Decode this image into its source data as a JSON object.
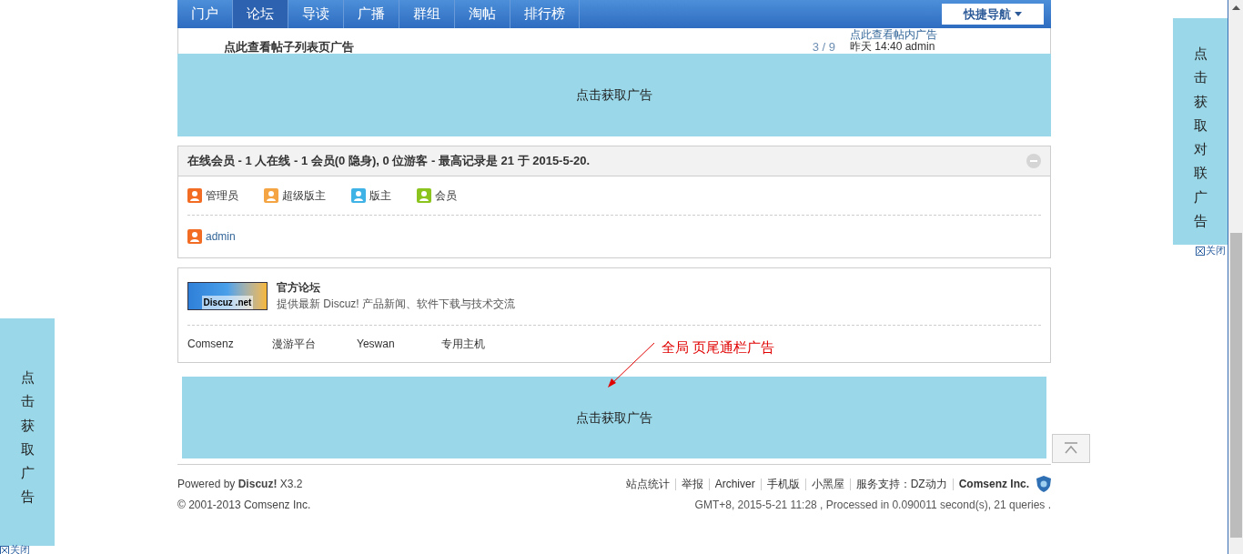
{
  "nav": {
    "items": [
      {
        "label": "门户",
        "selected": false
      },
      {
        "label": "论坛",
        "selected": true
      },
      {
        "label": "导读",
        "selected": false
      },
      {
        "label": "广播",
        "selected": false
      },
      {
        "label": "群组",
        "selected": false
      },
      {
        "label": "淘帖",
        "selected": false
      },
      {
        "label": "排行榜",
        "selected": false
      }
    ],
    "quick_nav": "快捷导航"
  },
  "thread_row": {
    "title": "点此查看帖子列表页广告",
    "pages": "3 / 9",
    "last_post_link": "点此查看帖内广告",
    "last_post": "昨天 14:40 admin"
  },
  "top_banner_ad": "点击获取广告",
  "online": {
    "header": "在线会员 - 1 人在线 - 1 会员(0 隐身), 0 位游客 - 最高记录是 21 于 2015-5-20.",
    "legend": [
      {
        "label": "管理员",
        "color": "#f26c24"
      },
      {
        "label": "超级版主",
        "color": "#f5a443"
      },
      {
        "label": "版主",
        "color": "#3fb2e6"
      },
      {
        "label": "会员",
        "color": "#8cc41f"
      }
    ],
    "users": [
      {
        "name": "admin",
        "color": "#f26c24"
      }
    ]
  },
  "friend_links": {
    "logo": "Discuz .net",
    "title": "官方论坛",
    "description": "提供最新 Discuz! 产品新闻、软件下载与技术交流",
    "links": [
      "Comsenz",
      "漫游平台",
      "Yeswan",
      "专用主机"
    ]
  },
  "annotation": "全局 页尾通栏广告",
  "footer_banner_ad": "点击获取广告",
  "footer": {
    "powered": "Powered by **Discuz!** X3.2",
    "copyright": "© 2001-2013 Comsenz Inc.",
    "links": [
      {
        "label": "站点统计",
        "bold": false
      },
      {
        "label": "举报",
        "bold": false
      },
      {
        "label": "Archiver",
        "bold": false
      },
      {
        "label": "手机版",
        "bold": false
      },
      {
        "label": "小黑屋",
        "bold": false
      },
      {
        "label": "服务支持：DZ动力",
        "bold": false
      },
      {
        "label": "Comsenz Inc.",
        "bold": true
      }
    ],
    "info": "GMT+8, 2015-5-21 11:28 , Processed in 0.090011 second(s), 21 queries ."
  },
  "right_couplet_ad": {
    "text": "点击获取对联广告",
    "close": "关闭"
  },
  "left_couplet_ad": {
    "text": "点击获取广告",
    "close": "关闭"
  }
}
